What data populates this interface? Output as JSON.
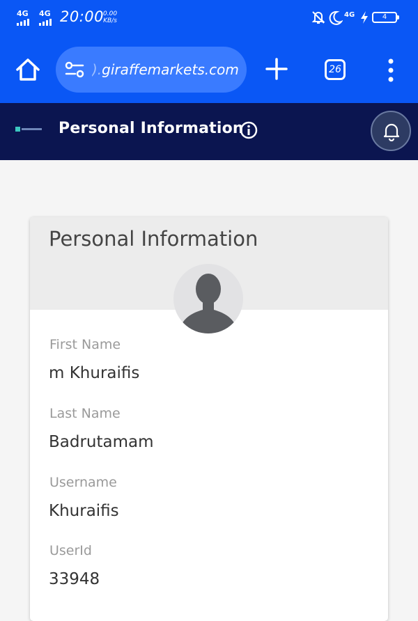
{
  "status_bar": {
    "signal_1": "4G",
    "signal_2": "4G",
    "time": "20:00",
    "speed_value": "0.00",
    "speed_unit": "KB/s",
    "network": "4G",
    "battery": "4",
    "icons": [
      "signal-icon",
      "mute-icon",
      "moon-icon",
      "charging-icon",
      "battery-icon"
    ]
  },
  "browser": {
    "url_faded": ").",
    "url": "giraffemarkets.com",
    "tab_count": "26",
    "icons": [
      "home-icon",
      "site-settings-icon",
      "plus-icon",
      "tabs-icon",
      "more-icon"
    ],
    "bar_color": "#0a57f5"
  },
  "site_header": {
    "title": "Personal Information",
    "background": "#0b1550",
    "icons": [
      "logo",
      "info-icon",
      "bell-icon"
    ]
  },
  "card": {
    "title": "Personal Information",
    "fields": [
      {
        "label": "First Name",
        "value": "m Khuraifis"
      },
      {
        "label": "Last Name",
        "value": "Badrutamam"
      },
      {
        "label": "Username",
        "value": "Khuraifis"
      },
      {
        "label": "UserId",
        "value": "33948"
      }
    ]
  }
}
